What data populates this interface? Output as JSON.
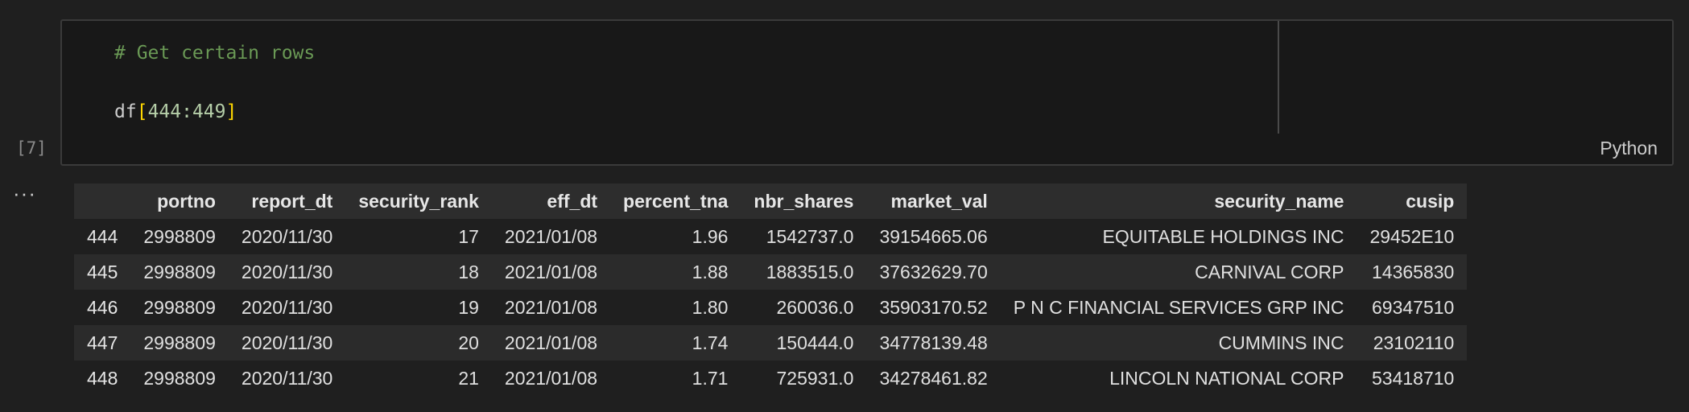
{
  "cell": {
    "code_comment": "# Get certain rows",
    "code_var": "df",
    "code_open": "[",
    "code_slice": "444:449",
    "code_close": "]",
    "language": "Python",
    "execution_count": "[7]",
    "output_menu": "···"
  },
  "table": {
    "columns": [
      "",
      "portno",
      "report_dt",
      "security_rank",
      "eff_dt",
      "percent_tna",
      "nbr_shares",
      "market_val",
      "security_name",
      "cusip"
    ],
    "rows": [
      [
        "444",
        "2998809",
        "2020/11/30",
        "17",
        "2021/01/08",
        "1.96",
        "1542737.0",
        "39154665.06",
        "EQUITABLE HOLDINGS INC",
        "29452E10"
      ],
      [
        "445",
        "2998809",
        "2020/11/30",
        "18",
        "2021/01/08",
        "1.88",
        "1883515.0",
        "37632629.70",
        "CARNIVAL CORP",
        "14365830"
      ],
      [
        "446",
        "2998809",
        "2020/11/30",
        "19",
        "2021/01/08",
        "1.80",
        "260036.0",
        "35903170.52",
        "P N C FINANCIAL SERVICES GRP INC",
        "69347510"
      ],
      [
        "447",
        "2998809",
        "2020/11/30",
        "20",
        "2021/01/08",
        "1.74",
        "150444.0",
        "34778139.48",
        "CUMMINS INC",
        "23102110"
      ],
      [
        "448",
        "2998809",
        "2020/11/30",
        "21",
        "2021/01/08",
        "1.71",
        "725931.0",
        "34278461.82",
        "LINCOLN NATIONAL CORP",
        "53418710"
      ]
    ]
  }
}
